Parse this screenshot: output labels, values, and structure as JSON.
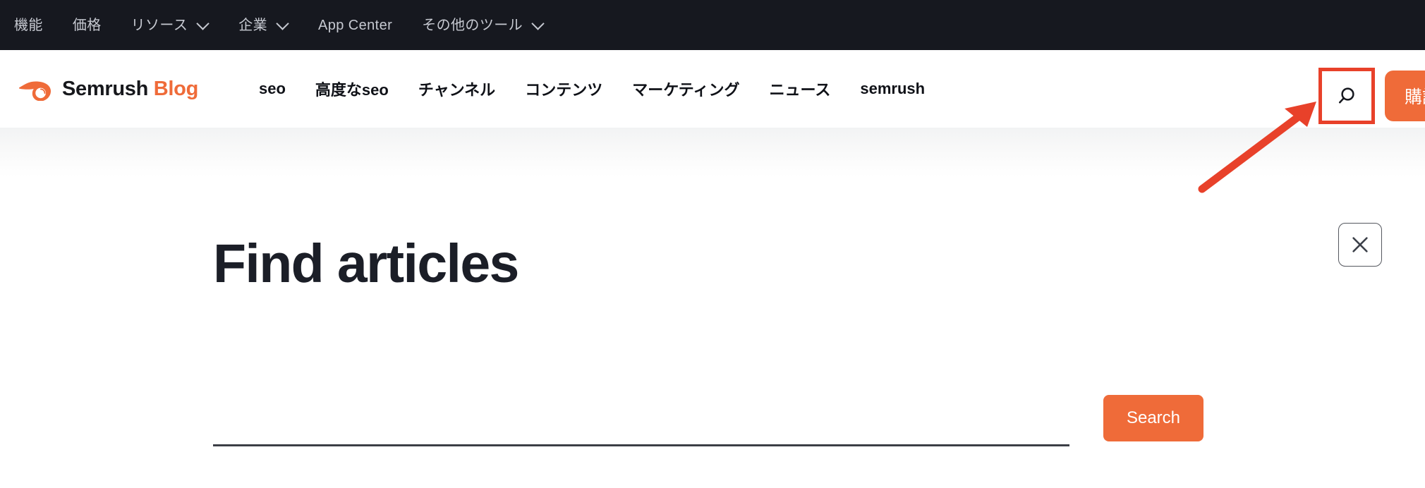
{
  "topbar": {
    "items": [
      {
        "label": "機能",
        "has_chevron": false,
        "icon": null
      },
      {
        "label": "価格",
        "has_chevron": false,
        "icon": null
      },
      {
        "label": "リソース",
        "has_chevron": true,
        "icon": "chevron-down-icon"
      },
      {
        "label": "企業",
        "has_chevron": true,
        "icon": "chevron-down-icon"
      },
      {
        "label": "App Center",
        "has_chevron": false,
        "icon": null
      },
      {
        "label": "その他のツール",
        "has_chevron": true,
        "icon": "chevron-down-icon"
      }
    ]
  },
  "header": {
    "brand": {
      "icon": "semrush-logo-icon",
      "name": "Semrush",
      "section": "Blog"
    },
    "nav": [
      {
        "label": "seo"
      },
      {
        "label": "高度なseo"
      },
      {
        "label": "チャンネル"
      },
      {
        "label": "コンテンツ"
      },
      {
        "label": "マーケティング"
      },
      {
        "label": "ニュース"
      },
      {
        "label": "semrush"
      }
    ],
    "search_toggle": {
      "icon": "search-icon",
      "label": ""
    },
    "subscribe_button": {
      "label": "購読"
    }
  },
  "search_panel": {
    "title": "Find articles",
    "input": {
      "value": "",
      "placeholder": ""
    },
    "submit_label": "Search",
    "close": {
      "icon": "close-icon",
      "label": ""
    }
  },
  "annotation": {
    "arrow": {
      "name": "pointer-arrow",
      "color": "#e8412a"
    },
    "highlight_box": {
      "name": "search-toggle-highlight",
      "color": "#e8412a"
    }
  },
  "colors": {
    "topbar_bg": "#16181f",
    "topbar_text": "#c6c9d1",
    "brand_accent": "#ef6b39",
    "heading": "#1b1e27",
    "annotation_red": "#e8412a",
    "page_bg": "#ffffff"
  }
}
